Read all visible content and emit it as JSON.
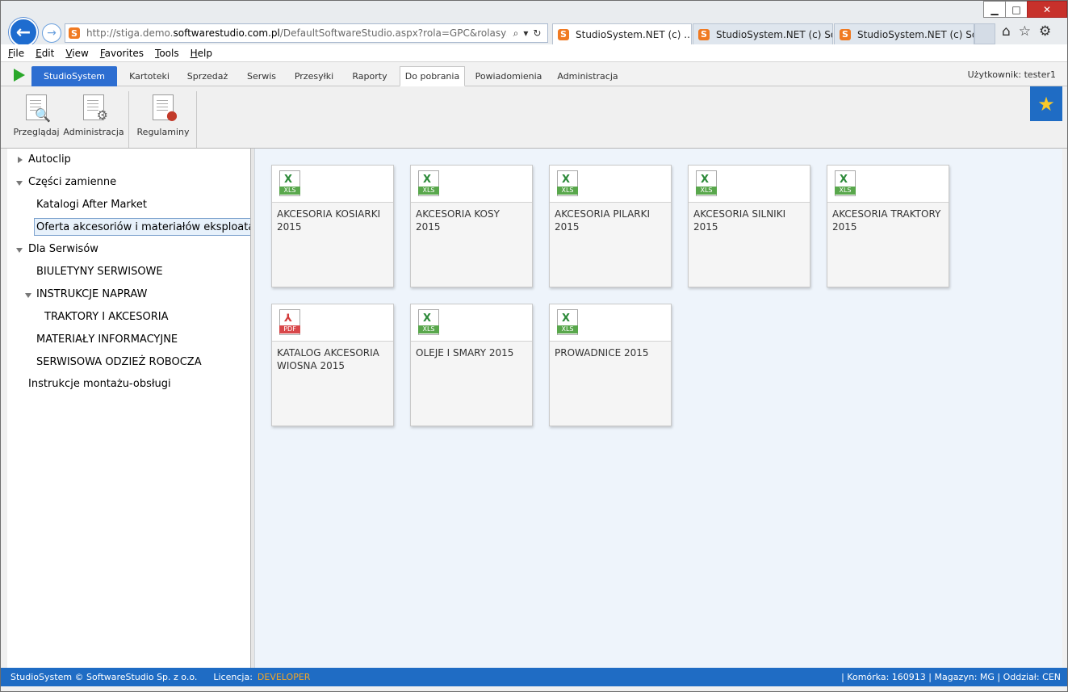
{
  "browser": {
    "window_controls": {
      "min": "▁",
      "max": "□",
      "close": "✕"
    },
    "back_icon": "←",
    "forward_icon": "→",
    "favicon_letter": "S",
    "url_prefix": "http://stiga.demo.",
    "url_domain": "softwarestudio.com.pl",
    "url_suffix": "/DefaultSoftwareStudio.aspx?rola=GPC&rolasys=GGP",
    "addr_tools": [
      "⌕",
      "▾",
      "↻"
    ],
    "tabs": [
      {
        "label": "StudioSystem.NET (c) ...",
        "close": "✕"
      },
      {
        "label": "StudioSystem.NET (c) Sof..."
      },
      {
        "label": "StudioSystem.NET (c) Sof..."
      }
    ],
    "icons": [
      "⌂",
      "☆",
      "⚙"
    ]
  },
  "menu": [
    {
      "label": "File",
      "key": "F",
      "rest": "ile"
    },
    {
      "label": "Edit",
      "key": "E",
      "rest": "dit"
    },
    {
      "label": "View",
      "key": "V",
      "rest": "iew"
    },
    {
      "label": "Favorites",
      "key": "F",
      "rest": "avorites"
    },
    {
      "label": "Tools",
      "key": "T",
      "rest": "ools"
    },
    {
      "label": "Help",
      "key": "H",
      "rest": "elp"
    }
  ],
  "nav": {
    "brand": "StudioSystem",
    "tabs": [
      "Kartoteki",
      "Sprzedaż",
      "Serwis",
      "Przesyłki",
      "Raporty",
      "Do pobrania",
      "Powiadomienia",
      "Administracja"
    ],
    "active_tab": "Do pobrania",
    "user": "Użytkownik: tester1"
  },
  "ribbon": {
    "buttons": [
      {
        "label": "Przeglądaj",
        "icon": "magnifier-icon",
        "glyph": "🔍"
      },
      {
        "label": "Administracja",
        "icon": "gear-icon",
        "glyph": "⚙"
      },
      {
        "label": "Regulaminy",
        "icon": "seal-icon",
        "glyph": "●"
      }
    ],
    "star": "★"
  },
  "tree": [
    {
      "label": "Autoclip"
    },
    {
      "label": "Części zamienne"
    },
    {
      "label": "Katalogi After Market"
    },
    {
      "label": "Oferta akcesoriów i materiałów eksploatacyjnych"
    },
    {
      "label": "Dla Serwisów"
    },
    {
      "label": "BIULETYNY SERWISOWE"
    },
    {
      "label": "INSTRUKCJE NAPRAW"
    },
    {
      "label": "TRAKTORY I AKCESORIA"
    },
    {
      "label": "MATERIAŁY INFORMACYJNE"
    },
    {
      "label": "SERWISOWA ODZIEŻ ROBOCZA"
    },
    {
      "label": "Instrukcje montażu-obsługi"
    }
  ],
  "files": [
    {
      "name": "AKCESORIA KOSIARKI 2015",
      "type": "XLS"
    },
    {
      "name": "AKCESORIA KOSY 2015",
      "type": "XLS"
    },
    {
      "name": "AKCESORIA PILARKI 2015",
      "type": "XLS"
    },
    {
      "name": "AKCESORIA SILNIKI 2015",
      "type": "XLS"
    },
    {
      "name": "AKCESORIA TRAKTORY 2015",
      "type": "XLS"
    },
    {
      "name": "KATALOG AKCESORIA WIOSNA 2015",
      "type": "PDF"
    },
    {
      "name": "OLEJE I SMARY 2015",
      "type": "XLS"
    },
    {
      "name": "PROWADNICE 2015",
      "type": "XLS"
    }
  ],
  "file_symbols": {
    "XLS": "X",
    "PDF": "⅄"
  },
  "status": {
    "copyright": "StudioSystem © SoftwareStudio Sp. z o.o.",
    "license_label": "Licencja:",
    "license_value": "DEVELOPER",
    "right": "| Komórka: 160913 | Magazyn: MG | Oddział: CEN"
  },
  "colors": {
    "accent": "#1f6cc4",
    "xls": "#59a74c",
    "pdf": "#d8474a",
    "license": "#f5a623"
  }
}
